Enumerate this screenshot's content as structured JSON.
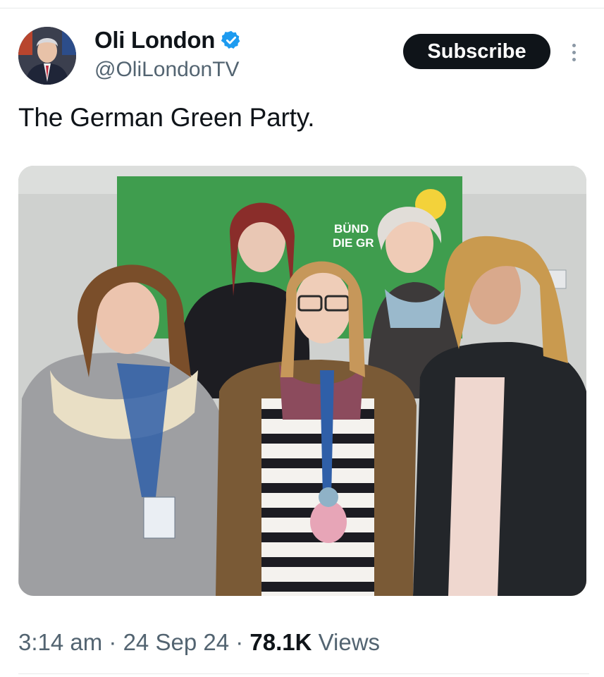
{
  "tweet": {
    "author": {
      "display_name": "Oli London",
      "handle": "@OliLondonTV",
      "verified": true
    },
    "subscribe_label": "Subscribe",
    "text": "The German Green Party.",
    "banner_text": {
      "line1": "BÜND",
      "line2": "DIE GR"
    },
    "meta": {
      "time": "3:14 am",
      "separator": " · ",
      "date": "24 Sep 24",
      "views_count": "78.1K",
      "views_label": "Views"
    }
  },
  "icons": {
    "verified": "verified-badge-icon",
    "more": "more-vertical-icon"
  },
  "colors": {
    "verified_blue": "#1d9bf0",
    "button_bg": "#0f1419",
    "secondary_text": "#536471",
    "banner_green": "#3f9d4e"
  }
}
